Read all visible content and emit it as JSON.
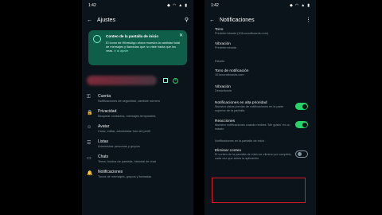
{
  "left": {
    "status": {
      "time": "1:42"
    },
    "appbar": {
      "title": "Ajustes"
    },
    "card": {
      "title": "Conteo de la pantalla de inicio",
      "body": "El ícono de WhatsApp ahora muestra la cantidad total de mensajes y llamadas que no viste hasta que los veas.",
      "link": "Ir al ajuste"
    },
    "menu": [
      {
        "icon": "key-icon",
        "glyph": "⚿",
        "title": "Cuenta",
        "sub": "Notificaciones de seguridad, cambiar número"
      },
      {
        "icon": "lock-icon",
        "glyph": "🔒",
        "title": "Privacidad",
        "sub": "Bloquear contactos, mensajes temporales"
      },
      {
        "icon": "avatar-icon",
        "glyph": "☺",
        "title": "Avatar",
        "sub": "Crear, editar, administrar foto del perfil"
      },
      {
        "icon": "lists-icon",
        "glyph": "☰",
        "title": "Listas",
        "sub": "Administrar personas y grupos"
      },
      {
        "icon": "chat-icon",
        "glyph": "▭",
        "title": "Chats",
        "sub": "Tema, fondos de pantalla, historial de chat"
      },
      {
        "icon": "bell-icon",
        "glyph": "🔔",
        "title": "Notificaciones",
        "sub": "Tonos de mensajes, grupos y llamadas"
      }
    ]
  },
  "right": {
    "status": {
      "time": "1:42"
    },
    "appbar": {
      "title": "Notificaciones"
    },
    "tono": {
      "title": "Tono",
      "sub": "Predeterminado (101soundboards.com)"
    },
    "vibracion1": {
      "title": "Vibración",
      "sub": "Predeterminada"
    },
    "estado_label": "Estado",
    "tono_notif": {
      "title": "Tono de notificación",
      "sub": "101soundboards.com"
    },
    "vibracion2": {
      "title": "Vibración",
      "sub": "Desactivada"
    },
    "alta_prioridad": {
      "title": "Notificaciones en alta prioridad",
      "sub": "Muestra vistas previas de notificaciones en la parte superior de la pantalla",
      "on": true
    },
    "reacciones": {
      "title": "Reacciones",
      "sub": "Muestra notificaciones cuando recibes \"Me gusta\" en un estado",
      "on": true
    },
    "inicio_label": "Notificaciones en la pantalla de inicio",
    "eliminar": {
      "title": "Eliminar conteo",
      "sub": "El conteo de la pantalla de inicio se elimina por completo cada vez que abres la aplicación",
      "on": false
    }
  }
}
